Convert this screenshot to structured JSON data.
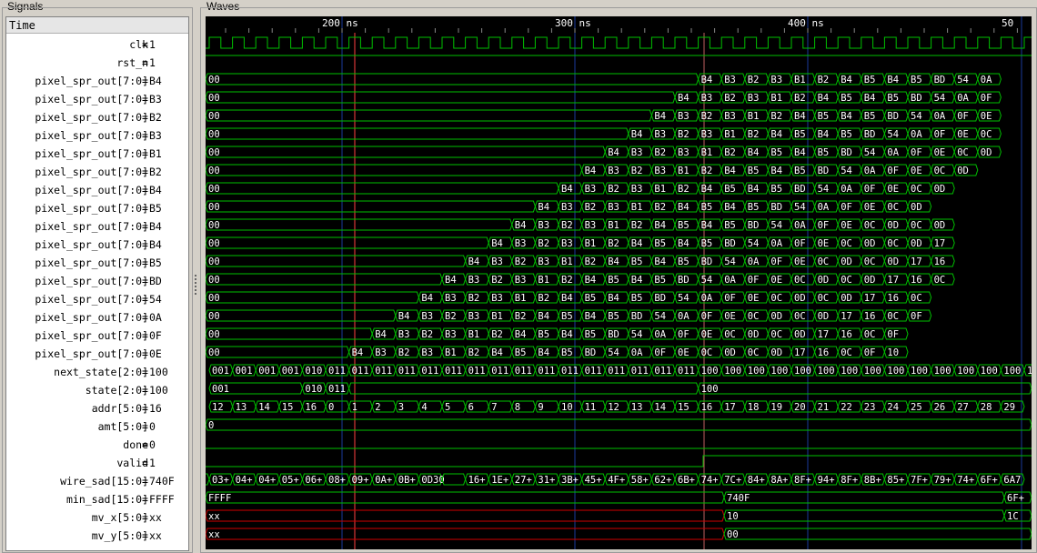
{
  "panels": {
    "signals_title": "Signals",
    "waves_title": "Waves",
    "time_header": "Time"
  },
  "timeline": {
    "ticks": [
      "200 ns",
      "300 ns",
      "400 ns",
      "50"
    ]
  },
  "signals": [
    {
      "name": "clk",
      "value": "1"
    },
    {
      "name": "rst_n",
      "value": "1"
    },
    {
      "name": "pixel_spr_out[7:0]",
      "value": "B4"
    },
    {
      "name": "pixel_spr_out[7:0]",
      "value": "B3"
    },
    {
      "name": "pixel_spr_out[7:0]",
      "value": "B2"
    },
    {
      "name": "pixel_spr_out[7:0]",
      "value": "B3"
    },
    {
      "name": "pixel_spr_out[7:0]",
      "value": "B1"
    },
    {
      "name": "pixel_spr_out[7:0]",
      "value": "B2"
    },
    {
      "name": "pixel_spr_out[7:0]",
      "value": "B4"
    },
    {
      "name": "pixel_spr_out[7:0]",
      "value": "B5"
    },
    {
      "name": "pixel_spr_out[7:0]",
      "value": "B4"
    },
    {
      "name": "pixel_spr_out[7:0]",
      "value": "B4"
    },
    {
      "name": "pixel_spr_out[7:0]",
      "value": "B5"
    },
    {
      "name": "pixel_spr_out[7:0]",
      "value": "BD"
    },
    {
      "name": "pixel_spr_out[7:0]",
      "value": "54"
    },
    {
      "name": "pixel_spr_out[7:0]",
      "value": "0A"
    },
    {
      "name": "pixel_spr_out[7:0]",
      "value": "0F"
    },
    {
      "name": "pixel_spr_out[7:0]",
      "value": "0E"
    },
    {
      "name": "next_state[2:0]",
      "value": "100"
    },
    {
      "name": "state[2:0]",
      "value": "100"
    },
    {
      "name": "addr[5:0]",
      "value": "16"
    },
    {
      "name": "amt[5:0]",
      "value": "0"
    },
    {
      "name": "done",
      "value": "0"
    },
    {
      "name": "valid",
      "value": "1"
    },
    {
      "name": "wire_sad[15:0]",
      "value": "740F"
    },
    {
      "name": "min_sad[15:0]",
      "value": "FFFF"
    },
    {
      "name": "mv_x[5:0]",
      "value": "xx"
    },
    {
      "name": "mv_y[5:0]",
      "value": "xx"
    }
  ],
  "waves": {
    "pixel_sequence": [
      "B4",
      "B3",
      "B2",
      "B3",
      "B1",
      "B2",
      "B4",
      "B5",
      "B4",
      "B5",
      "BD",
      "54",
      "0A",
      "0F",
      "0E",
      "0C",
      "0D",
      "0C",
      "0D",
      "17",
      "16",
      "0C",
      "0F",
      "10"
    ],
    "pixel_rows": [
      {
        "start": 21,
        "labels": [
          "B4",
          "B3",
          "B2",
          "B3",
          "B1",
          "B2",
          "B4",
          "B5",
          "B4",
          "B5",
          "BD",
          "54",
          "0A"
        ]
      },
      {
        "start": 20,
        "labels": [
          "B4",
          "B3",
          "B2",
          "B3",
          "B1",
          "B2",
          "B4",
          "B5",
          "B4",
          "B5",
          "BD",
          "54",
          "0A",
          "0F"
        ]
      },
      {
        "start": 19,
        "labels": [
          "B4",
          "B3",
          "B2",
          "B3",
          "B1",
          "B2",
          "B4",
          "B5",
          "B4",
          "B5",
          "BD",
          "54",
          "0A",
          "0F",
          "0E"
        ]
      },
      {
        "start": 18,
        "labels": [
          "B4",
          "B3",
          "B2",
          "B3",
          "B1",
          "B2",
          "B4",
          "B5",
          "B4",
          "B5",
          "BD",
          "54",
          "0A",
          "0F",
          "0E",
          "0C"
        ]
      },
      {
        "start": 17,
        "labels": [
          "B4",
          "B3",
          "B2",
          "B3",
          "B1",
          "B2",
          "B4",
          "B5",
          "B4",
          "B5",
          "BD",
          "54",
          "0A",
          "0F",
          "0E",
          "0C",
          "0D"
        ]
      },
      {
        "start": 16,
        "labels": [
          "B4",
          "B3",
          "B2",
          "B3",
          "B1",
          "B2",
          "B4",
          "B5",
          "B4",
          "B5",
          "BD",
          "54",
          "0A",
          "0F",
          "0E",
          "0C",
          "0D"
        ]
      },
      {
        "start": 15,
        "labels": [
          "B4",
          "B3",
          "B2",
          "B3",
          "B1",
          "B2",
          "B4",
          "B5",
          "B4",
          "B5",
          "BD",
          "54",
          "0A",
          "0F",
          "0E",
          "0C",
          "0D"
        ]
      },
      {
        "start": 14,
        "labels": [
          "B4",
          "B3",
          "B2",
          "B3",
          "B1",
          "B2",
          "B4",
          "B5",
          "B4",
          "B5",
          "BD",
          "54",
          "0A",
          "0F",
          "0E",
          "0C",
          "0D"
        ]
      },
      {
        "start": 13,
        "labels": [
          "B4",
          "B3",
          "B2",
          "B3",
          "B1",
          "B2",
          "B4",
          "B5",
          "B4",
          "B5",
          "BD",
          "54",
          "0A",
          "0F",
          "0E",
          "0C",
          "0D",
          "0C",
          "0D"
        ]
      },
      {
        "start": 12,
        "labels": [
          "B4",
          "B3",
          "B2",
          "B3",
          "B1",
          "B2",
          "B4",
          "B5",
          "B4",
          "B5",
          "BD",
          "54",
          "0A",
          "0F",
          "0E",
          "0C",
          "0D",
          "0C",
          "0D",
          "17"
        ]
      },
      {
        "start": 11,
        "labels": [
          "B4",
          "B3",
          "B2",
          "B3",
          "B1",
          "B2",
          "B4",
          "B5",
          "B4",
          "B5",
          "BD",
          "54",
          "0A",
          "0F",
          "0E",
          "0C",
          "0D",
          "0C",
          "0D",
          "17",
          "16"
        ]
      },
      {
        "start": 10,
        "labels": [
          "B4",
          "B3",
          "B2",
          "B3",
          "B1",
          "B2",
          "B4",
          "B5",
          "B4",
          "B5",
          "BD",
          "54",
          "0A",
          "0F",
          "0E",
          "0C",
          "0D",
          "0C",
          "0D",
          "17",
          "16",
          "0C"
        ]
      },
      {
        "start": 9,
        "labels": [
          "B4",
          "B3",
          "B2",
          "B3",
          "B1",
          "B2",
          "B4",
          "B5",
          "B4",
          "B5",
          "BD",
          "54",
          "0A",
          "0F",
          "0E",
          "0C",
          "0D",
          "0C",
          "0D",
          "17",
          "16",
          "0C"
        ]
      },
      {
        "start": 8,
        "labels": [
          "B4",
          "B3",
          "B2",
          "B3",
          "B1",
          "B2",
          "B4",
          "B5",
          "B4",
          "B5",
          "BD",
          "54",
          "0A",
          "0F",
          "0E",
          "0C",
          "0D",
          "0C",
          "0D",
          "17",
          "16",
          "0C",
          "0F"
        ]
      },
      {
        "start": 7,
        "labels": [
          "B4",
          "B3",
          "B2",
          "B3",
          "B1",
          "B2",
          "B4",
          "B5",
          "B4",
          "B5",
          "BD",
          "54",
          "0A",
          "0F",
          "0E",
          "0C",
          "0D",
          "0C",
          "0D",
          "17",
          "16",
          "0C",
          "0F"
        ]
      },
      {
        "start": 6,
        "labels": [
          "B4",
          "B3",
          "B2",
          "B3",
          "B1",
          "B2",
          "B4",
          "B5",
          "B4",
          "B5",
          "BD",
          "54",
          "0A",
          "0F",
          "0E",
          "0C",
          "0D",
          "0C",
          "0D",
          "17",
          "16",
          "0C",
          "0F",
          "10"
        ]
      }
    ],
    "pixel_initial": "00",
    "next_state": [
      "001",
      "001",
      "001",
      "001",
      "010",
      "011",
      "011",
      "011",
      "011",
      "011",
      "011",
      "011",
      "011",
      "011",
      "011",
      "011",
      "011",
      "011",
      "011",
      "011",
      "011",
      "100",
      "100",
      "100",
      "100",
      "100",
      "100",
      "100",
      "100",
      "100",
      "100",
      "100",
      "100",
      "100",
      "100",
      "100",
      "100"
    ],
    "state": [
      {
        "from": 0,
        "to": 4,
        "label": "001"
      },
      {
        "from": 4,
        "to": 5,
        "label": "010"
      },
      {
        "from": 5,
        "to": 6,
        "label": "011"
      },
      {
        "from": 6,
        "to": 21,
        "label": ""
      },
      {
        "from": 21,
        "to": 36,
        "label": "100"
      }
    ],
    "addr": [
      "12",
      "13",
      "14",
      "15",
      "16",
      "0",
      "1",
      "2",
      "3",
      "4",
      "5",
      "6",
      "7",
      "8",
      "9",
      "10",
      "11",
      "12",
      "13",
      "14",
      "15",
      "16",
      "17",
      "18",
      "19",
      "20",
      "21",
      "22",
      "23",
      "24",
      "25",
      "26",
      "27",
      "28",
      "29"
    ],
    "amt": "0",
    "wire_sad": [
      "",
      "03+",
      "04+",
      "04+",
      "05+",
      "06+",
      "08+",
      "09+",
      "0A+",
      "0B+",
      "0D30",
      "",
      "16+",
      "1E+",
      "27+",
      "31+",
      "3B+",
      "45+",
      "4F+",
      "58+",
      "62+",
      "6B+",
      "74+",
      "7C+",
      "84+",
      "8A+",
      "8F+",
      "94+",
      "8F+",
      "8B+",
      "85+",
      "7F+",
      "79+",
      "74+",
      "6F+",
      "6A7"
    ],
    "min_sad": [
      {
        "label": "FFFF"
      },
      {
        "label": "740F"
      },
      {
        "label": "6F+"
      }
    ],
    "mv_x": [
      {
        "label": "xx"
      },
      {
        "label": "10"
      },
      {
        "label": "1C"
      }
    ],
    "mv_y": [
      {
        "label": "xx"
      },
      {
        "label": "00"
      }
    ]
  },
  "colors": {
    "wave": "#00c000",
    "unknown": "#d00000",
    "cursor": "#ff4040",
    "grid": "#1a3a9a",
    "text": "#ffffff",
    "bg": "#000000"
  }
}
